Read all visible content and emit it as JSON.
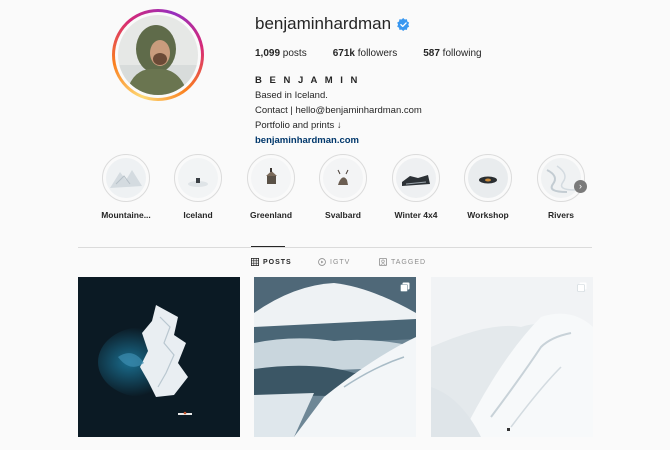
{
  "profile": {
    "username": "benjaminhardman",
    "verified": true,
    "stats": {
      "posts_count": "1,099",
      "posts_label": " posts",
      "followers_count": "671k",
      "followers_label": " followers",
      "following_count": "587",
      "following_label": " following"
    },
    "full_name": "B E N J A M I N",
    "bio": [
      "Based in Iceland.",
      "Contact | hello@benjaminhardman.com",
      "Portfolio and prints ↓"
    ],
    "website": "benjaminhardman.com"
  },
  "highlights": [
    {
      "label": "Mountaine..."
    },
    {
      "label": "Iceland"
    },
    {
      "label": "Greenland"
    },
    {
      "label": "Svalbard"
    },
    {
      "label": "Winter 4x4"
    },
    {
      "label": "Workshop"
    },
    {
      "label": "Rivers"
    }
  ],
  "tabs": [
    {
      "label": "POSTS",
      "icon": "grid-icon",
      "active": true
    },
    {
      "label": "IGTV",
      "icon": "igtv-icon",
      "active": false
    },
    {
      "label": "TAGGED",
      "icon": "tag-icon",
      "active": false
    }
  ],
  "posts": [
    {
      "subject": "aerial iceberg in dark water with kayak",
      "multi": false
    },
    {
      "subject": "snowy mountain range under sky",
      "multi": true
    },
    {
      "subject": "white snow-covered mountain slope",
      "multi": true
    }
  ],
  "colors": {
    "accent_blue": "#0095f6",
    "link": "#00376b",
    "text": "#262626",
    "muted": "#8e8e8e",
    "border": "#dbdbdb",
    "background": "#fafafa"
  }
}
